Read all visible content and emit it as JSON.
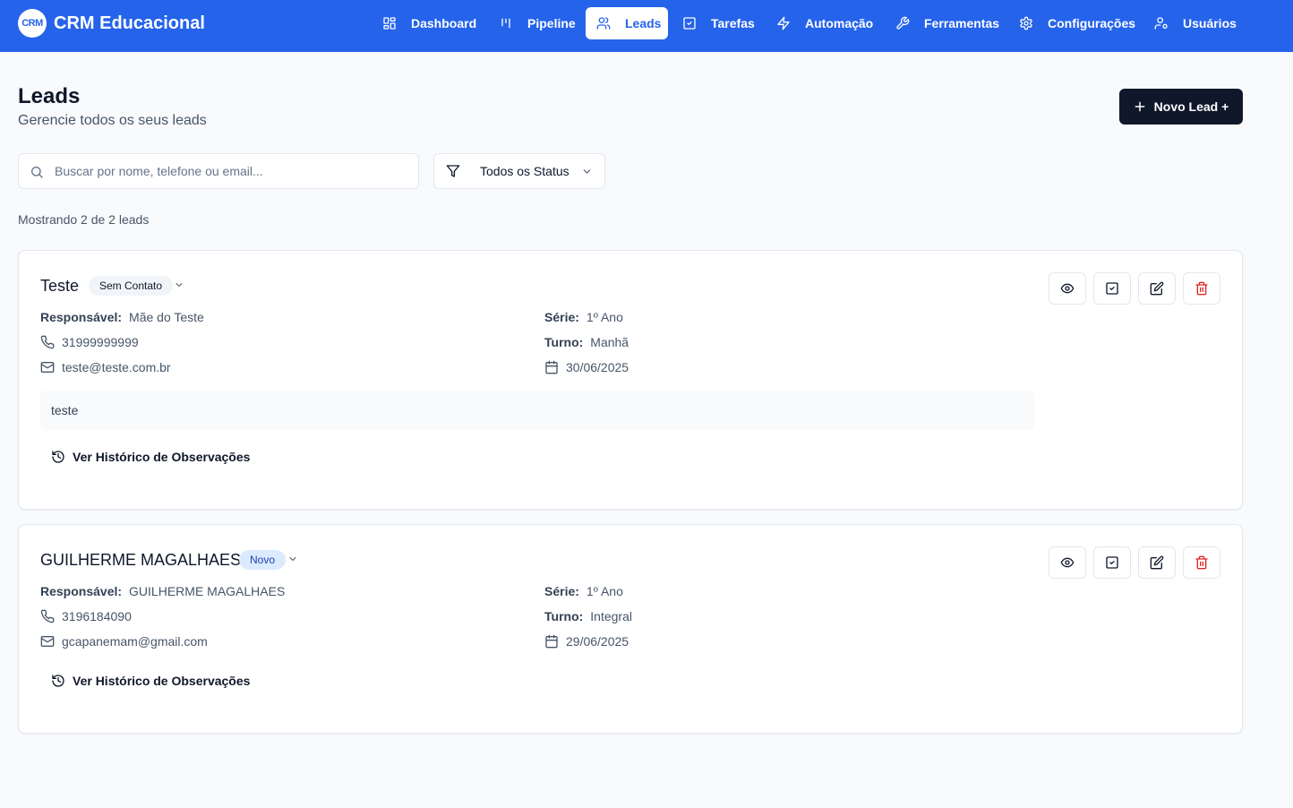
{
  "brand": {
    "logo_text": "CRM",
    "name": "CRM Educacional"
  },
  "nav": [
    {
      "label": "Dashboard",
      "icon": "dashboard-icon"
    },
    {
      "label": "Pipeline",
      "icon": "pipeline-icon"
    },
    {
      "label": "Leads",
      "icon": "users-icon",
      "active": true
    },
    {
      "label": "Tarefas",
      "icon": "check-square-icon"
    },
    {
      "label": "Automação",
      "icon": "zap-icon"
    },
    {
      "label": "Ferramentas",
      "icon": "wrench-icon"
    },
    {
      "label": "Configurações",
      "icon": "gear-icon"
    },
    {
      "label": "Usuários",
      "icon": "user-cog-icon"
    }
  ],
  "page": {
    "title": "Leads",
    "subtitle": "Gerencie todos os seus leads",
    "new_lead_label": "Novo Lead +"
  },
  "search": {
    "placeholder": "Buscar por nome, telefone ou email...",
    "value": ""
  },
  "status_filter": {
    "selected": "Todos os Status"
  },
  "results": {
    "count_text": "Mostrando 2 de 2 leads"
  },
  "labels": {
    "responsavel": "Responsável:",
    "serie": "Série:",
    "turno": "Turno:",
    "history": "Ver Histórico de Observações"
  },
  "leads": [
    {
      "name": "Teste",
      "status": "Sem Contato",
      "responsavel": "Mãe do Teste",
      "phone": "31999999999",
      "email": "teste@teste.com.br",
      "serie": "1º Ano",
      "turno": "Manhã",
      "date": "30/06/2025",
      "note": "teste"
    },
    {
      "name": "GUILHERME MAGALHAES",
      "status": "Novo",
      "responsavel": "GUILHERME MAGALHAES",
      "phone": "3196184090",
      "email": "gcapanemam@gmail.com",
      "serie": "1º Ano",
      "turno": "Integral",
      "date": "29/06/2025",
      "note": ""
    }
  ],
  "colors": {
    "primary": "#2563eb",
    "dark_button": "#0f172a",
    "danger": "#dc2626",
    "badge_blue_bg": "#dbeafe",
    "badge_gray_bg": "#f1f5f9"
  }
}
